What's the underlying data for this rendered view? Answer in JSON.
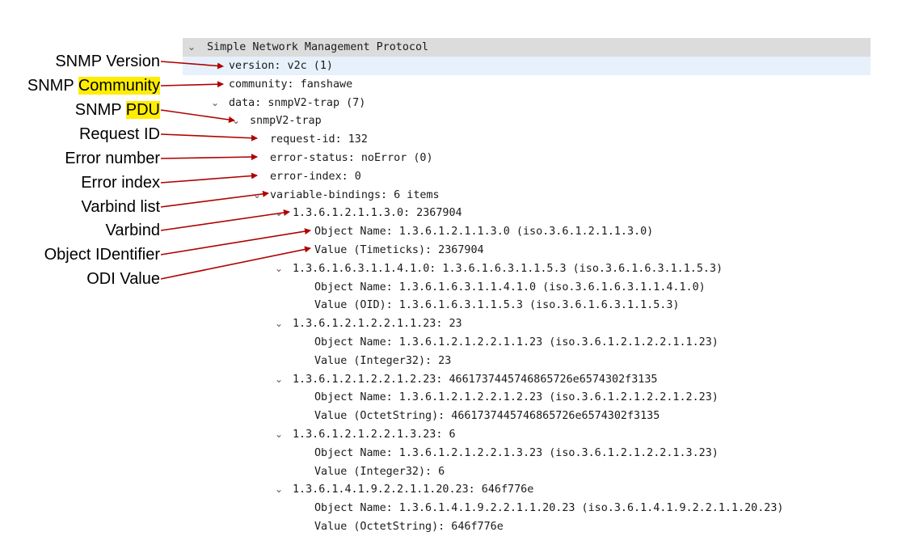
{
  "tree": {
    "header": "Simple Network Management Protocol",
    "rows": [
      {
        "text": "version: v2c (1)"
      },
      {
        "text": "community: fanshawe"
      },
      {
        "text": "data: snmpV2-trap (7)"
      },
      {
        "text": "snmpV2-trap"
      },
      {
        "text": "request-id: 132"
      },
      {
        "text": "error-status: noError (0)"
      },
      {
        "text": "error-index: 0"
      },
      {
        "text": "variable-bindings: 6 items"
      },
      {
        "text": "1.3.6.1.2.1.1.3.0: 2367904"
      },
      {
        "text": "Object Name: 1.3.6.1.2.1.1.3.0 (iso.3.6.1.2.1.1.3.0)"
      },
      {
        "text": "Value (Timeticks): 2367904"
      },
      {
        "text": "1.3.6.1.6.3.1.1.4.1.0: 1.3.6.1.6.3.1.1.5.3 (iso.3.6.1.6.3.1.1.5.3)"
      },
      {
        "text": "Object Name: 1.3.6.1.6.3.1.1.4.1.0 (iso.3.6.1.6.3.1.1.4.1.0)"
      },
      {
        "text": "Value (OID): 1.3.6.1.6.3.1.1.5.3 (iso.3.6.1.6.3.1.1.5.3)"
      },
      {
        "text": "1.3.6.1.2.1.2.2.1.1.23: 23"
      },
      {
        "text": "Object Name: 1.3.6.1.2.1.2.2.1.1.23 (iso.3.6.1.2.1.2.2.1.1.23)"
      },
      {
        "text": "Value (Integer32): 23"
      },
      {
        "text": "1.3.6.1.2.1.2.2.1.2.23: 4661737445746865726e6574302f3135"
      },
      {
        "text": "Object Name: 1.3.6.1.2.1.2.2.1.2.23 (iso.3.6.1.2.1.2.2.1.2.23)"
      },
      {
        "text": "Value (OctetString): 4661737445746865726e6574302f3135"
      },
      {
        "text": "1.3.6.1.2.1.2.2.1.3.23: 6"
      },
      {
        "text": "Object Name: 1.3.6.1.2.1.2.2.1.3.23 (iso.3.6.1.2.1.2.2.1.3.23)"
      },
      {
        "text": "Value (Integer32): 6"
      },
      {
        "text": "1.3.6.1.4.1.9.2.2.1.1.20.23: 646f776e"
      },
      {
        "text": "Object Name: 1.3.6.1.4.1.9.2.2.1.1.20.23 (iso.3.6.1.4.1.9.2.2.1.1.20.23)"
      },
      {
        "text": "Value (OctetString): 646f776e"
      }
    ]
  },
  "annotations": [
    {
      "text": "SNMP Version"
    },
    {
      "text": "SNMP ",
      "highlight": "Community"
    },
    {
      "text": "SNMP ",
      "highlight": "PDU"
    },
    {
      "text": "Request ID"
    },
    {
      "text": "Error number"
    },
    {
      "text": "Error index"
    },
    {
      "text": "Varbind list"
    },
    {
      "text": "Varbind"
    },
    {
      "text": "Object IDentifier"
    },
    {
      "text": "ODI Value"
    }
  ],
  "icons": {
    "expanded": "chevron-down-icon"
  },
  "colors": {
    "arrow": "#b00000",
    "highlight": "#ffed00",
    "header_row": "#dcdcdc",
    "selected_row": "#e6f1fc"
  }
}
